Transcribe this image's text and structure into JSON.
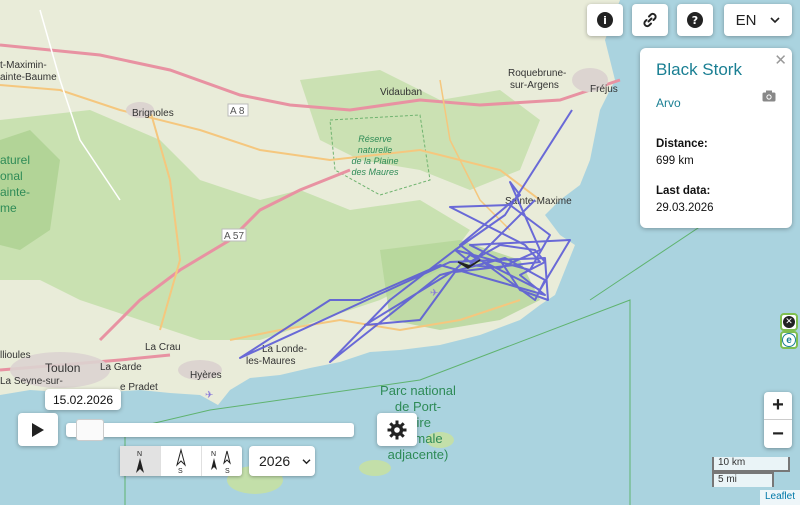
{
  "toolbar": {
    "info_icon": "info-icon",
    "link_icon": "link-icon",
    "help_icon": "help-icon",
    "language": "EN"
  },
  "map_labels": {
    "saint_maximin": "t-Maximin-",
    "sainte_baume": "ainte-Baume",
    "brignoles": "Brignoles",
    "vidauban": "Vidauban",
    "roquebrune": "Roquebrune-",
    "sur_argens": "sur-Argens",
    "frejus": "Fréjus",
    "a8": "A 8",
    "a57": "A 57",
    "reserve": [
      "Réserve",
      "naturelle",
      "de la Plaine",
      "des Maures"
    ],
    "park_left": [
      "aturel",
      "onal",
      "ainte-",
      "me"
    ],
    "sainte_maxime": "Sainte-Maxime",
    "toulon": "Toulon",
    "ollioules": "llioules",
    "la_crau": "La Crau",
    "la_garde": "La Garde",
    "la_seyne": "La Seyne-sur-",
    "le_pradet": "e Pradet",
    "hyeres": "Hyères",
    "la_londe": [
      "La Londe-",
      "les-Maures"
    ],
    "parc_national": [
      "Parc national",
      "de Port-",
      "(aire",
      "optimale",
      "adjacente)"
    ]
  },
  "animal": {
    "species": "Black Stork",
    "name": "Arvo",
    "distance_label": "Distance:",
    "distance_value": "699 km",
    "last_data_label": "Last data:",
    "last_data_value": "29.03.2026",
    "track_color": "#5b5bd6"
  },
  "timeline": {
    "current_date": "15.02.2026",
    "year": "2026",
    "progress": 0.03
  },
  "scale": {
    "metric": "10 km",
    "imperial": "5 mi"
  },
  "attribution": "Leaflet",
  "colors": {
    "water": "#aad3df",
    "land": "#e8ead8",
    "forest": "#b9d8a0",
    "motorway": "#e892a2",
    "accent": "#1a7f93"
  }
}
